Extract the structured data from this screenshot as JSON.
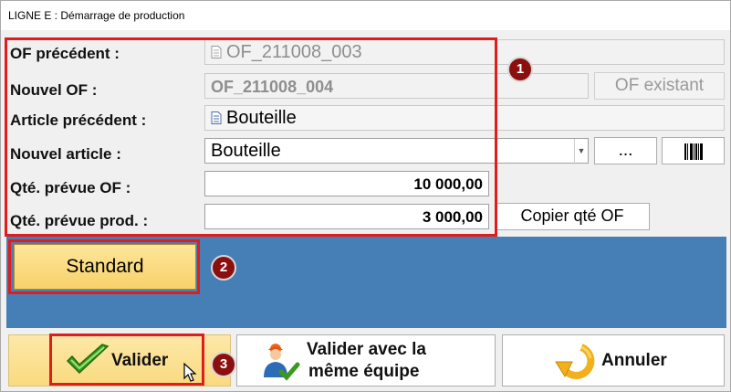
{
  "window": {
    "title": "LIGNE E : Démarrage de production"
  },
  "form": {
    "of_precedent": {
      "label": "OF précédent :",
      "value": "OF_211008_003"
    },
    "nouvel_of": {
      "label": "Nouvel OF :",
      "value": "OF_211008_004"
    },
    "of_existant_label": "OF existant",
    "article_precedent": {
      "label": "Article précédent :",
      "value": "Bouteille"
    },
    "nouvel_article": {
      "label": "Nouvel article :",
      "value": "Bouteille"
    },
    "browse_label": "...",
    "qte_prevue_of": {
      "label": "Qté. prévue OF :",
      "value": "10 000,00"
    },
    "qte_prevue_prod": {
      "label": "Qté. prévue prod. :",
      "value": "3 000,00"
    },
    "copier_label": "Copier qté OF"
  },
  "panel": {
    "standard_label": "Standard"
  },
  "actions": {
    "valider_label": "Valider",
    "valider_equipe_line1": "Valider avec la",
    "valider_equipe_line2": "même équipe",
    "annuler_label": "Annuler"
  },
  "badges": [
    "1",
    "2",
    "3"
  ],
  "icons": {
    "doc": "document-icon",
    "barcode": "barcode-icon",
    "check": "checkmark-icon",
    "team": "user-check-icon",
    "undo": "undo-arrow-icon",
    "cursor": "mouse-cursor-icon"
  },
  "colors": {
    "accent_red": "#e21c1c",
    "badge": "#8b0f0f",
    "panel_blue": "#467fb6",
    "button_yellow": "#f8d26a"
  }
}
